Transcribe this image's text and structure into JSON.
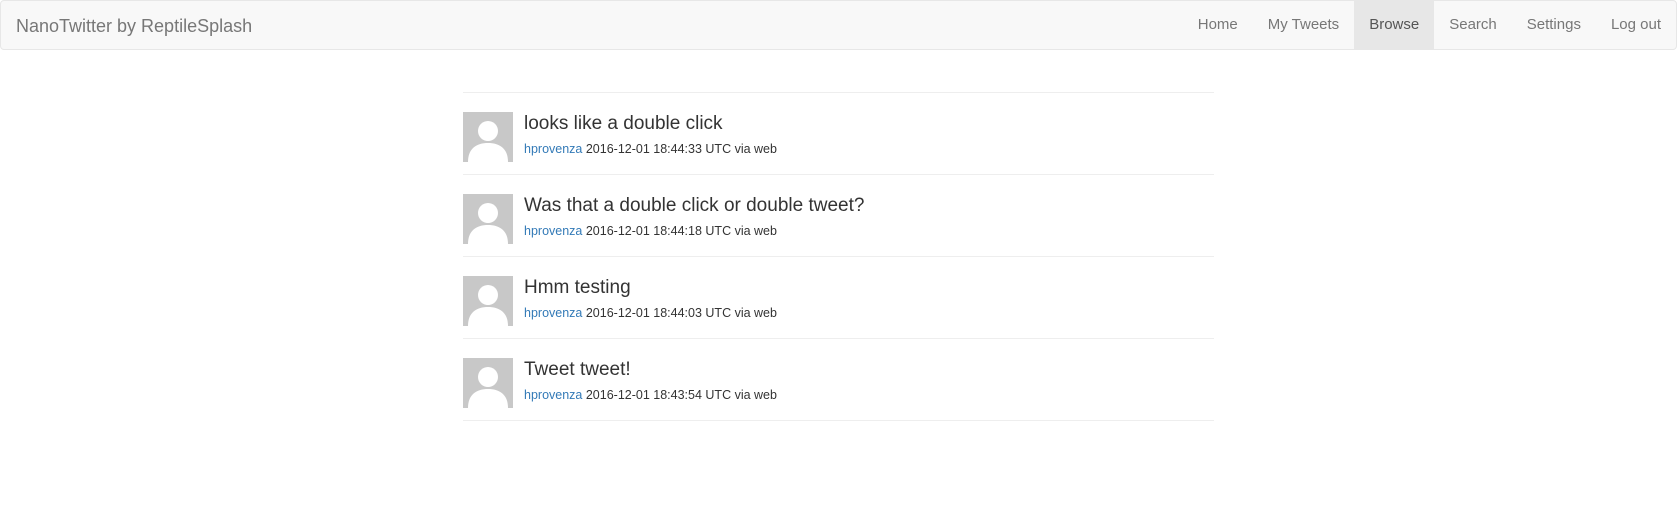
{
  "navbar": {
    "brand": "NanoTwitter by ReptileSplash",
    "items": [
      {
        "label": "Home",
        "active": false
      },
      {
        "label": "My Tweets",
        "active": false
      },
      {
        "label": "Browse",
        "active": true
      },
      {
        "label": "Search",
        "active": false
      },
      {
        "label": "Settings",
        "active": false
      },
      {
        "label": "Log out",
        "active": false
      }
    ]
  },
  "tweets": [
    {
      "text": "looks like a double click",
      "user": "hprovenza",
      "timestamp": "2016-12-01 18:44:33 UTC",
      "source": "via web",
      "avatar_icon": "default-user-avatar-icon"
    },
    {
      "text": "Was that a double click or double tweet?",
      "user": "hprovenza",
      "timestamp": "2016-12-01 18:44:18 UTC",
      "source": "via web",
      "avatar_icon": "default-user-avatar-icon"
    },
    {
      "text": "Hmm testing",
      "user": "hprovenza",
      "timestamp": "2016-12-01 18:44:03 UTC",
      "source": "via web",
      "avatar_icon": "default-user-avatar-icon"
    },
    {
      "text": "Tweet tweet!",
      "user": "hprovenza",
      "timestamp": "2016-12-01 18:43:54 UTC",
      "source": "via web",
      "avatar_icon": "default-user-avatar-icon"
    }
  ],
  "colors": {
    "link": "#337ab7",
    "navbar_bg": "#f8f8f8",
    "nav_active_bg": "#e7e7e7",
    "avatar_bg": "#c8c8c8"
  }
}
